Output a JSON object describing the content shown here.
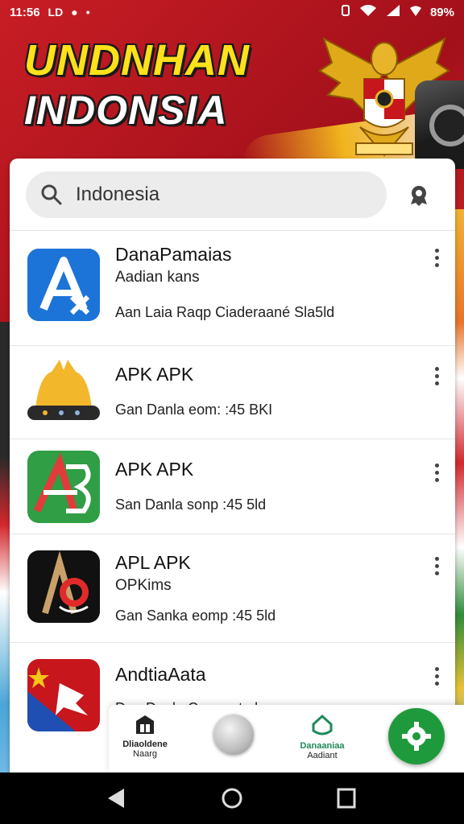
{
  "status_bar": {
    "time": "11:56",
    "left_icons": [
      "LD",
      "●",
      "•"
    ],
    "battery": "89%"
  },
  "hero": {
    "title_line1": "UNDNHAN",
    "title_line2": "INDONSIA"
  },
  "search": {
    "value": "Indonesia"
  },
  "apps": [
    {
      "name": "DanaPamaias",
      "subtitle": "Aadian kans",
      "meta": "Aan Laia Raqp Ciaderaané Sla5ld",
      "icon": "app-a-blue-icon"
    },
    {
      "name": "APK APK",
      "subtitle": "",
      "meta": "Gan Danla eom: :45 BKI",
      "icon": "yellow-hat-icon"
    },
    {
      "name": "APK APK",
      "subtitle": "",
      "meta": "San Danla sonp :45 5ld",
      "icon": "app-ab-green-icon"
    },
    {
      "name": "APL APK",
      "subtitle": "OPKims",
      "meta": "Gan Sanka eomp :45 5ld",
      "icon": "app-a-black-icon"
    },
    {
      "name": "AndtiaAata",
      "subtitle": "",
      "meta": "Dan Danla Com:eat ala",
      "icon": "flag-red-blue-icon"
    }
  ],
  "bottom_nav": {
    "left_label": "Dliaoldene",
    "left_sub": "Naarg",
    "right_label": "Danaaniaa",
    "right_sub": "Aadiant"
  },
  "colors": {
    "brand_red": "#b01722",
    "title_yellow": "#ffe11a",
    "fab_green": "#1e9a3c",
    "search_bg": "#ececec"
  }
}
